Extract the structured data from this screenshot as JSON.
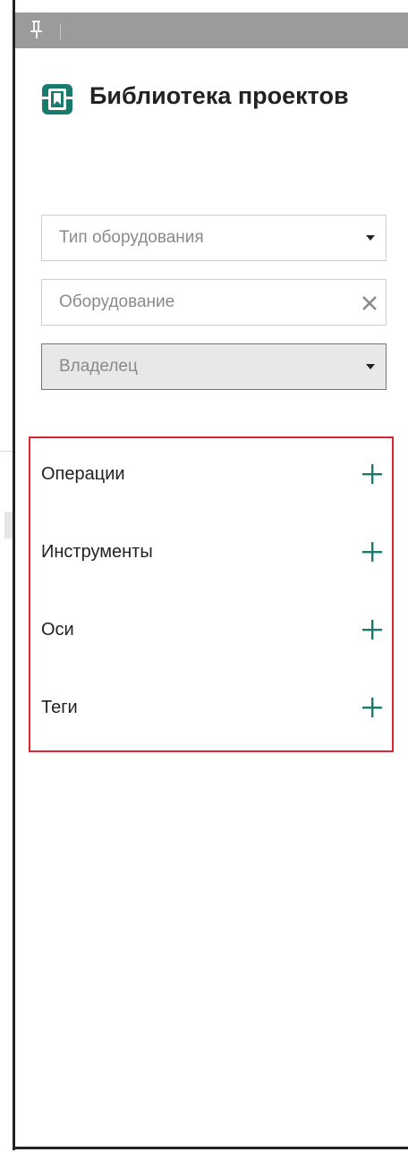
{
  "header": {
    "title": "Библиотека проектов",
    "logo_icon": "book-library-icon",
    "accent_color": "#1a7a6c"
  },
  "topbar": {
    "pin_icon": "pin-icon"
  },
  "filters": {
    "equipment_type": {
      "placeholder": "Тип оборудования",
      "icon": "caret-down-icon"
    },
    "equipment": {
      "placeholder": "Оборудование",
      "icon": "close-icon"
    },
    "owner": {
      "placeholder": "Владелец",
      "icon": "caret-down-icon",
      "state": "disabled"
    }
  },
  "sections": [
    {
      "label": "Операции",
      "icon": "plus-icon"
    },
    {
      "label": "Инструменты",
      "icon": "plus-icon"
    },
    {
      "label": "Оси",
      "icon": "plus-icon"
    },
    {
      "label": "Теги",
      "icon": "plus-icon"
    }
  ],
  "highlight_color": "#d9262f"
}
